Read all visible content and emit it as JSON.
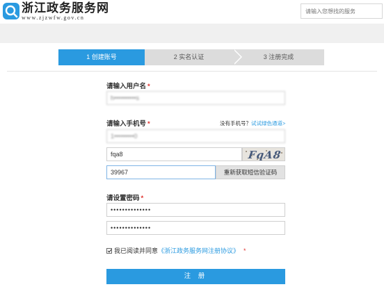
{
  "header": {
    "brand_title": "浙江政务服务网",
    "brand_url": "www.zjzwfw.gov.cn",
    "search_placeholder": "请输入您想找的服务",
    "brand_color": "#2a9ae0"
  },
  "steps": [
    {
      "label": "1 创建账号",
      "active": true
    },
    {
      "label": "2 实名认证",
      "active": false
    },
    {
      "label": "3 注册完成",
      "active": false
    }
  ],
  "form": {
    "username_label": "请输入用户名",
    "username_value": "h••••••••••s",
    "phone_label": "请输入手机号",
    "no_phone_text": "没有手机号？",
    "green_channel_link": "试试绿色通道>",
    "phone_value": "1•••••••••0",
    "captcha_value": "fqa8",
    "captcha_image_text": "FqA8",
    "sms_code_value": "39967",
    "sms_button_label": "重新获取短信验证码",
    "password_label": "请设置密码",
    "password_value": "••••••••••••••",
    "password_confirm_value": "••••••••••••••",
    "agree_text": "我已阅读并同意",
    "agreement_link": "《浙江政务服务网注册协议》",
    "required_mark": "*",
    "submit_label": "注 册"
  },
  "colors": {
    "accent": "#2a9ae0",
    "required": "#e0322e",
    "step_inactive": "#dcdcdc"
  }
}
